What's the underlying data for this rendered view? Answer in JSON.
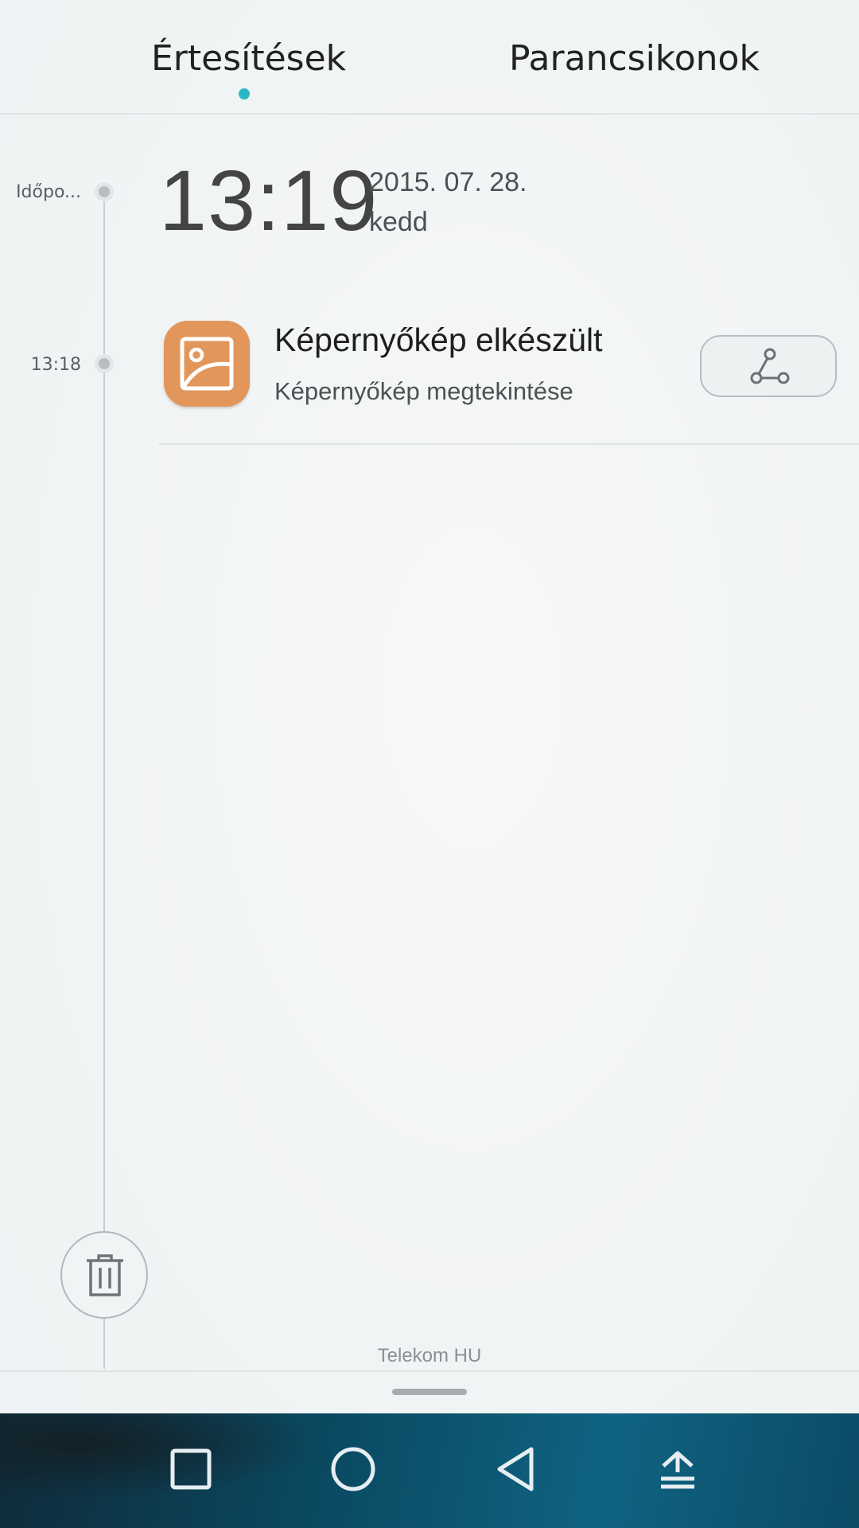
{
  "tabs": {
    "notifications": "Értesítések",
    "shortcuts": "Parancsikonok",
    "active_tab": "notifications",
    "accent_color": "#2bb7c3"
  },
  "timeline": {
    "header_label": "Időpo...",
    "entry_label": "13:18"
  },
  "clock": {
    "time": "13:19",
    "date": "2015. 07. 28.",
    "weekday": "kedd"
  },
  "notification": {
    "icon": "gallery-icon",
    "icon_color": "#e2965a",
    "title": "Képernyőkép elkészült",
    "subtitle": "Képernyőkép megtekintése",
    "action_icon": "share-icon"
  },
  "footer": {
    "carrier": "Telekom HU"
  },
  "navbar": {
    "buttons": [
      "recents-icon",
      "home-icon",
      "back-icon",
      "notification-pulldown-icon"
    ]
  }
}
